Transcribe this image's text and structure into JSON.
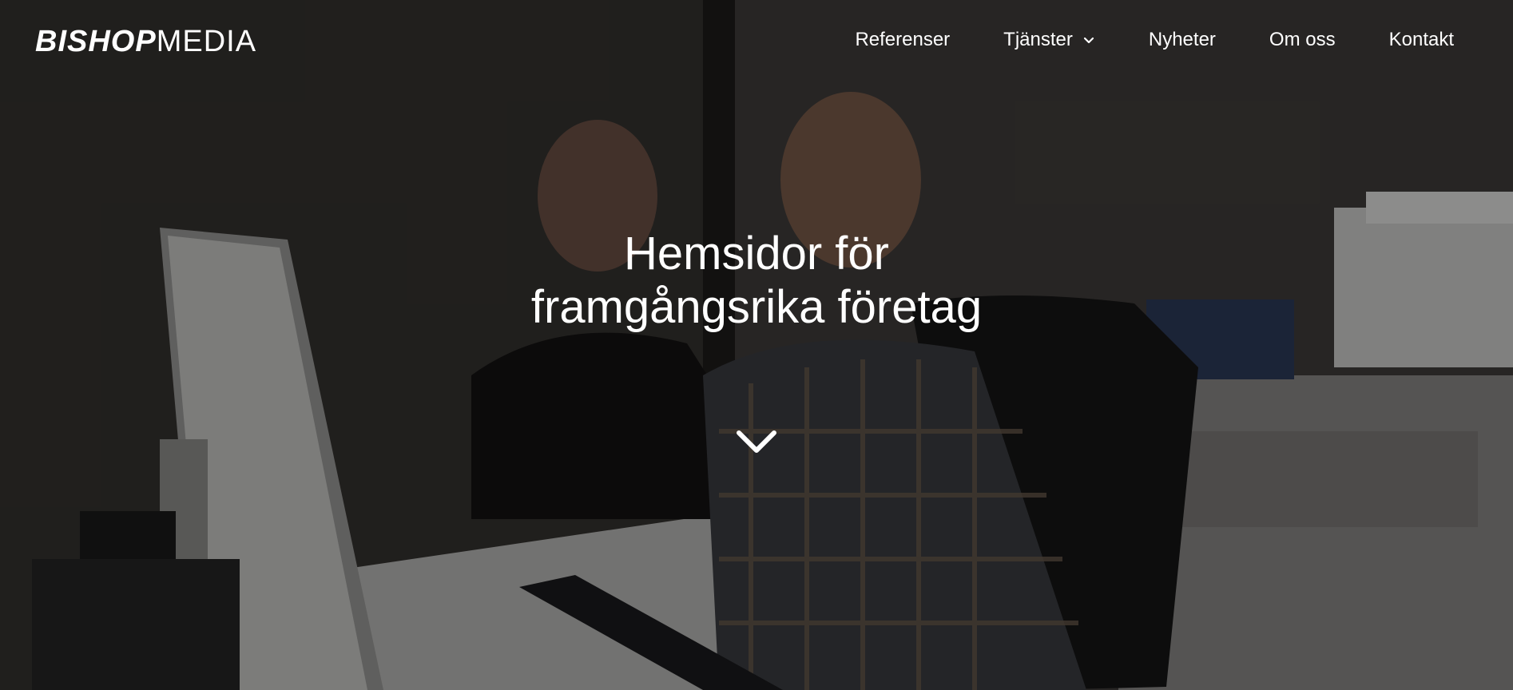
{
  "brand": {
    "logo_bold": "BISHOP",
    "logo_light": "MEDIA"
  },
  "nav": {
    "items": [
      {
        "label": "Referenser"
      },
      {
        "label": "Tjänster",
        "has_dropdown": true
      },
      {
        "label": "Nyheter"
      },
      {
        "label": "Om oss"
      },
      {
        "label": "Kontakt"
      }
    ]
  },
  "hero": {
    "headline_line1": "Hemsidor för",
    "headline_line2": "framgångsrika företag",
    "scroll_icon": "chevron-down-icon"
  },
  "colors": {
    "text": "#ffffff",
    "overlay": "#000000"
  }
}
